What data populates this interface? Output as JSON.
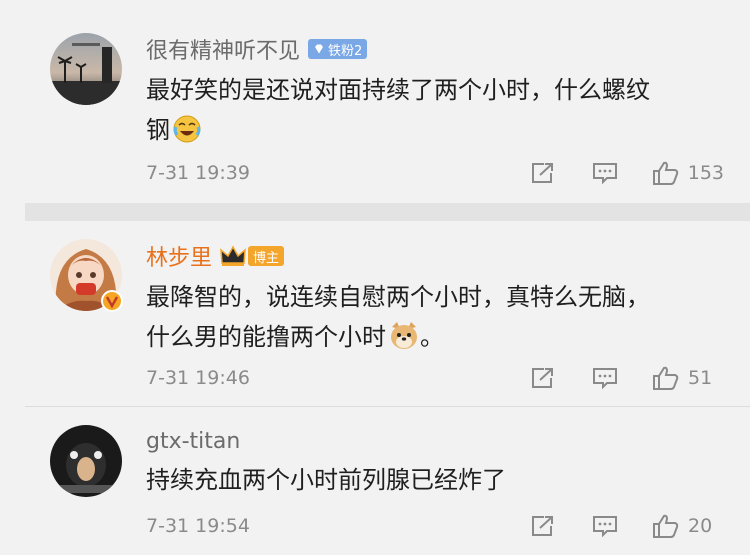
{
  "comments": [
    {
      "username": "很有精神听不见",
      "badge": "铁粉2",
      "text_line1": "最好笑的是还说对面持续了两个小时，什么螺纹",
      "text_line2": "钢",
      "emoji": "laugh-cry-emoji",
      "timestamp": "7-31 19:39",
      "likes": "153"
    },
    {
      "username": "林步里",
      "badge": "博主",
      "text_line1": "最降智的，说连续自慰两个小时，真特么无脑，",
      "text_line2": "什么男的能撸两个小时",
      "text_tail": "。",
      "emoji": "doge-emoji",
      "timestamp": "7-31 19:46",
      "likes": "51"
    },
    {
      "username": "gtx-titan",
      "text_line1": "持续充血两个小时前列腺已经炸了",
      "timestamp": "7-31 19:54",
      "likes": "20"
    }
  ],
  "icons": {
    "share": "share-icon",
    "reply": "comment-icon",
    "like": "thumbs-up-icon",
    "fans_badge": "diamond-icon",
    "host_badge": "crown-icon",
    "verified": "verified-v-icon"
  },
  "colors": {
    "background": "#f2f2f2",
    "separator": "#e3e3e3",
    "username": "#6b6b6b",
    "host_username": "#e8711b",
    "text": "#1f1f1f",
    "meta": "#8a8a8a",
    "fans_badge": "#7aa7e6",
    "host_badge": "#f3a52c"
  }
}
